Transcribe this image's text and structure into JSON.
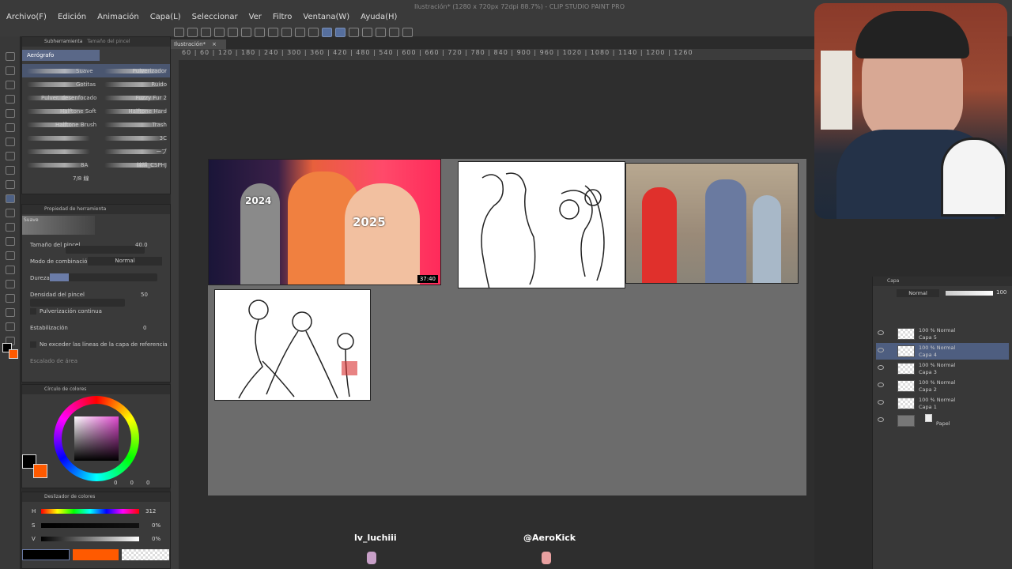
{
  "window_title": "Ilustración* (1280 x 720px 72dpi 88.7%) - CLIP STUDIO PAINT PRO",
  "menu": [
    "Archivo(F)",
    "Edición",
    "Animación",
    "Capa(L)",
    "Seleccionar",
    "Ver",
    "Filtro",
    "Ventana(W)",
    "Ayuda(H)"
  ],
  "canvas_tab": "Ilustración*",
  "ruler_ticks": "60 | 60 | 120 | 180 | 240 | 300 | 360 | 420 | 480 | 540 | 600 | 660 | 720 | 780 | 840 | 900 | 960 | 1020 | 1080 | 1140 | 1200 | 1260",
  "subtool_panel": {
    "tab_active": "Subherramienta",
    "tab_other": "Tamaño del pincel",
    "group": "Aerógrafo",
    "brushes": [
      {
        "left": "Suave",
        "right": "Pulverizador"
      },
      {
        "left": "Gotitas",
        "right": "Ruido"
      },
      {
        "left": "Pulver. desenfocado",
        "right": "Fuzzy Fur 2"
      },
      {
        "left": "Halftone Soft",
        "right": "Halftone Hard"
      },
      {
        "left": "Halftone Brush",
        "right": "Trash"
      },
      {
        "left": "",
        "right": "3C"
      },
      {
        "left": "",
        "right": "ーブ"
      },
      {
        "left": "8A",
        "right": "線描_CSPHJ"
      },
      {
        "left": "7/8 線",
        "right": ""
      }
    ]
  },
  "tool_property": {
    "title": "Propiedad de herramienta",
    "preview_label": "Suave",
    "brush_size_label": "Tamaño del pincel",
    "brush_size_value": "40.0",
    "blend_label": "Modo de combinación",
    "blend_value": "Normal",
    "hardness_label": "Dureza",
    "density_label": "Densidad del pincel",
    "density_value": "50",
    "continuous_label": "Pulverización continua",
    "stabilization_label": "Estabilización",
    "stabilization_value": "0",
    "no_exceed_label": "No exceder las líneas de la capa de referencia",
    "area_label": "Escalado de área"
  },
  "color_wheel": {
    "title": "Círculo de colores",
    "values": [
      "0",
      "0",
      "0"
    ]
  },
  "color_slider": {
    "title": "Deslizador de colores",
    "h_label": "H",
    "h_value": "312",
    "s_label": "S",
    "s_value": "0%",
    "v_label": "V",
    "v_value": "0%"
  },
  "colors": {
    "main": "#000000",
    "sub": "#ff5a00",
    "accent": "#5d7db8"
  },
  "layers": {
    "tab": "Capa",
    "blend": "Normal",
    "opacity": "100",
    "items": [
      {
        "mode": "100 % Normal",
        "name": "Capa 5",
        "selected": false
      },
      {
        "mode": "100 % Normal",
        "name": "Capa 4",
        "selected": true
      },
      {
        "mode": "100 % Normal",
        "name": "Capa 3",
        "selected": false
      },
      {
        "mode": "100 % Normal",
        "name": "Capa 2",
        "selected": false
      },
      {
        "mode": "100 % Normal",
        "name": "Capa 1",
        "selected": false
      },
      {
        "mode": "",
        "name": "Papel",
        "selected": false
      }
    ]
  },
  "canvas": {
    "thumb1_years": [
      "2024",
      "2025"
    ],
    "thumb1_duration": "37:40"
  },
  "overlay": {
    "user_left": "lv_luchiii",
    "user_right": "@AeroKick"
  }
}
